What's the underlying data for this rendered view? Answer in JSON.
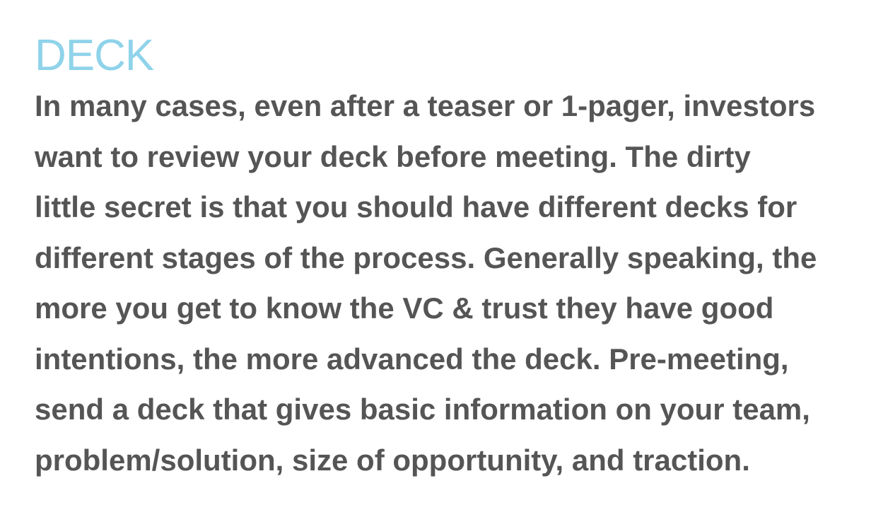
{
  "colors": {
    "heading": "#8fd3ea",
    "body": "#555555",
    "background": "#ffffff"
  },
  "section": {
    "heading": "DECK",
    "paragraph_lines": [
      "In many cases, even after a teaser or 1-pager, investors",
      "want to review your deck before meeting. The dirty",
      "little secret is that you should have different decks for",
      "different stages of the process. Generally speaking, the",
      "more you get to know the VC & trust they have good",
      "intentions, the more advanced the deck. Pre-meeting,",
      "send a deck that gives basic information on your team,",
      "problem/solution, size of opportunity, and traction."
    ]
  }
}
